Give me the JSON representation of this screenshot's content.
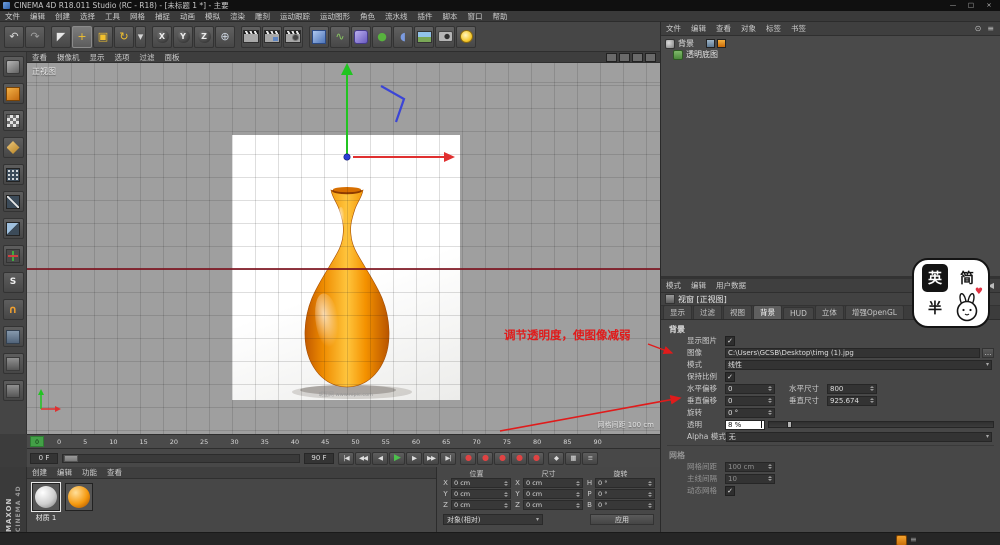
{
  "window": {
    "title": "CINEMA 4D R18.011 Studio (RC - R18) - [未标题 1 *] - 主要",
    "minimize_glyph": "—",
    "maximize_glyph": "□",
    "close_glyph": "×"
  },
  "menubar": [
    "文件",
    "编辑",
    "创建",
    "选择",
    "工具",
    "网格",
    "捕捉",
    "动画",
    "模拟",
    "渲染",
    "雕刻",
    "运动跟踪",
    "运动图形",
    "角色",
    "流水线",
    "插件",
    "脚本",
    "窗口",
    "帮助"
  ],
  "toolbar": [
    {
      "name": "undo-button",
      "glyph": "↶",
      "color": "#d8d8d8"
    },
    {
      "name": "redo-button",
      "glyph": "↷",
      "color": "#9f9f9f"
    },
    {
      "variant": "divider"
    },
    {
      "name": "live-selection-tool",
      "glyph": "◤",
      "color": "#e8e8e8"
    },
    {
      "name": "move-tool",
      "glyph": "+",
      "color": "#f2c12e",
      "variant": "active"
    },
    {
      "name": "scale-tool",
      "glyph": "▣",
      "color": "#f2c12e"
    },
    {
      "name": "rotate-tool",
      "glyph": "↻",
      "color": "#f2c12e"
    },
    {
      "name": "last-used-tool",
      "glyph": "▾",
      "variant": "narrow"
    },
    {
      "variant": "divider"
    },
    {
      "name": "lock-x-axis-button",
      "glyph": "X",
      "variant": "axis"
    },
    {
      "name": "lock-y-axis-button",
      "glyph": "Y",
      "variant": "axis"
    },
    {
      "name": "lock-z-axis-button",
      "glyph": "Z",
      "variant": "axis"
    },
    {
      "name": "coordinate-system-button",
      "glyph": "⊕",
      "color": "#cdd5e0"
    },
    {
      "variant": "divider"
    },
    {
      "name": "render-view-button",
      "variant": "clapper"
    },
    {
      "name": "render-picture-viewer-button",
      "variant": "clapper2"
    },
    {
      "name": "render-settings-button",
      "variant": "clapper3"
    },
    {
      "variant": "divider"
    },
    {
      "name": "add-cube-button",
      "variant": "cube"
    },
    {
      "name": "add-spline-button",
      "glyph": "∿",
      "color": "#8bc962"
    },
    {
      "name": "add-subdivision-button",
      "variant": "subdiv"
    },
    {
      "name": "add-mograph-button",
      "glyph": "●",
      "color": "#58b33e"
    },
    {
      "name": "add-deformer-button",
      "glyph": "◖",
      "color": "#7b9be0"
    },
    {
      "name": "add-environment-button",
      "variant": "floor"
    },
    {
      "name": "add-camera-button",
      "variant": "camera"
    },
    {
      "name": "add-light-button",
      "variant": "light"
    }
  ],
  "left_toolbar": [
    {
      "name": "make-editable-button",
      "variant": "convert"
    },
    {
      "name": "model-mode-button",
      "variant": "model"
    },
    {
      "name": "texture-mode-button",
      "variant": "texture"
    },
    {
      "name": "workplane-mode-button",
      "variant": "workplane"
    },
    {
      "name": "points-mode-button",
      "variant": "points"
    },
    {
      "name": "edges-mode-button",
      "variant": "edges"
    },
    {
      "name": "polygons-mode-button",
      "variant": "polys"
    },
    {
      "name": "enable-axis-button",
      "variant": "axis2"
    },
    {
      "name": "viewport-solo-button",
      "variant": "solo",
      "glyph": "S"
    },
    {
      "name": "enable-snap-button",
      "variant": "snap",
      "glyph": "∩"
    },
    {
      "name": "workplane-lock-button",
      "variant": "lockwp"
    },
    {
      "name": "tool-history-button",
      "variant": "misc"
    },
    {
      "name": "quick-tools-button",
      "variant": "misc"
    }
  ],
  "viewport": {
    "menu": [
      "查看",
      "摄像机",
      "显示",
      "选项",
      "过滤",
      "面板"
    ],
    "label": "正视图",
    "grid_spacing_info": "网格间距  100 cm",
    "image_watermark": "昵图网 www.nipic.com"
  },
  "annotation": {
    "text": "调节透明度，使图像减弱",
    "color": "#e01b1b"
  },
  "object_manager": {
    "menu": [
      "文件",
      "编辑",
      "查看",
      "对象",
      "标签",
      "书签"
    ],
    "rows": [
      {
        "name": "背景"
      },
      {
        "name": "透明底图"
      }
    ]
  },
  "attribute_manager": {
    "menu": [
      "模式",
      "编辑",
      "用户数据"
    ],
    "collapse_glyph": "◀",
    "title": "视窗 [正视图]",
    "tabs": [
      {
        "label": "显示"
      },
      {
        "label": "过滤"
      },
      {
        "label": "视图"
      },
      {
        "label": "背景",
        "active": true
      },
      {
        "label": "HUD"
      },
      {
        "label": "立体"
      },
      {
        "label": "增强OpenGL"
      }
    ],
    "background_section": {
      "title": "背景",
      "show_image_label": "显示图片",
      "image_label": "图像",
      "image_path": "C:\\Users\\GCSB\\Desktop\\timg (1).jpg",
      "mode_label": "模式",
      "mode_value": "线性",
      "keep_aspect_label": "保持比例",
      "h_offset_label": "水平偏移",
      "h_offset_value": "0",
      "h_size_label": "水平尺寸",
      "h_size_value": "800",
      "v_offset_label": "垂直偏移",
      "v_offset_value": "0",
      "v_size_label": "垂直尺寸",
      "v_size_value": "925.674",
      "rotation_label": "旋转",
      "rotation_value": "0 °",
      "transparency_label": "透明",
      "transparency_value": "8 %",
      "transparency_percent": 8,
      "alpha_label": "Alpha 模式",
      "alpha_value": "无"
    },
    "grid_section": {
      "title": "网格",
      "spacing_label": "网格间距",
      "spacing_value": "100 cm",
      "interval_label": "主线间隔",
      "interval_value": "10",
      "dynamic_label": "动态网格"
    }
  },
  "timeline": {
    "current": "0",
    "ticks": [
      "0",
      "5",
      "10",
      "15",
      "20",
      "25",
      "30",
      "35",
      "40",
      "45",
      "50",
      "55",
      "60",
      "65",
      "70",
      "75",
      "80",
      "85",
      "90"
    ]
  },
  "transport": {
    "start_value": "0 F",
    "end_value": "90 F",
    "buttons": [
      {
        "name": "goto-start-button",
        "glyph": "|◀"
      },
      {
        "name": "prev-key-button",
        "glyph": "◀◀"
      },
      {
        "name": "prev-frame-button",
        "glyph": "◀"
      },
      {
        "name": "play-button",
        "glyph": "▶",
        "variant": "play"
      },
      {
        "name": "next-frame-button",
        "glyph": "▶"
      },
      {
        "name": "next-key-button",
        "glyph": "▶▶"
      },
      {
        "name": "goto-end-button",
        "glyph": "▶|"
      }
    ],
    "record_buttons": [
      {
        "name": "record-keyframe-button",
        "glyph": "●",
        "variant": "rec"
      },
      {
        "name": "autokey-button",
        "glyph": "●",
        "variant": "rec"
      },
      {
        "name": "record-position-button",
        "glyph": "●",
        "variant": "rec"
      },
      {
        "name": "record-scale-button",
        "glyph": "●",
        "variant": "rec"
      },
      {
        "name": "record-rotation-button",
        "glyph": "●",
        "variant": "rec"
      }
    ],
    "extra_buttons": [
      {
        "name": "keyframe-selection-button",
        "glyph": "◆"
      },
      {
        "name": "timeline-window-button",
        "glyph": "▦"
      },
      {
        "name": "options-button",
        "glyph": "≡"
      }
    ]
  },
  "materials": {
    "menu": [
      "创建",
      "编辑",
      "功能",
      "查看"
    ],
    "items": [
      {
        "label": "材质 1",
        "variant": "matwhite",
        "selected": true
      },
      {
        "label": "",
        "variant": "matorange"
      }
    ]
  },
  "coordinates": {
    "pos_title": "位置",
    "size_title": "尺寸",
    "rot_title": "旋转",
    "pos_rows": [
      {
        "axis": "X",
        "value": "0 cm"
      },
      {
        "axis": "Y",
        "value": "0 cm"
      },
      {
        "axis": "Z",
        "value": "0 cm"
      }
    ],
    "size_rows": [
      {
        "axis": "X",
        "value": "0 cm"
      },
      {
        "axis": "Y",
        "value": "0 cm"
      },
      {
        "axis": "Z",
        "value": "0 cm"
      }
    ],
    "rot_rows": [
      {
        "axis": "H",
        "value": "0 °"
      },
      {
        "axis": "P",
        "value": "0 °"
      },
      {
        "axis": "B",
        "value": "0 °"
      }
    ],
    "mode_value": "对象(相对)",
    "apply_label": "应用"
  },
  "branding": {
    "maxon": "MAXON",
    "product": "CINEMA 4D"
  },
  "sticker": {
    "char1": "英",
    "char2": "简",
    "char3": "半",
    "heart": "♥"
  },
  "ui": {
    "check": "✓",
    "caret": "▾",
    "browse": "…",
    "search": "⊙",
    "list": "≡"
  },
  "colors": {
    "gizmo_green": "#21c421",
    "gizmo_red": "#e03030",
    "gizmo_blue": "#2b3fd6",
    "annotation_red": "#e01b1b",
    "vase_orange": "#f08800"
  }
}
